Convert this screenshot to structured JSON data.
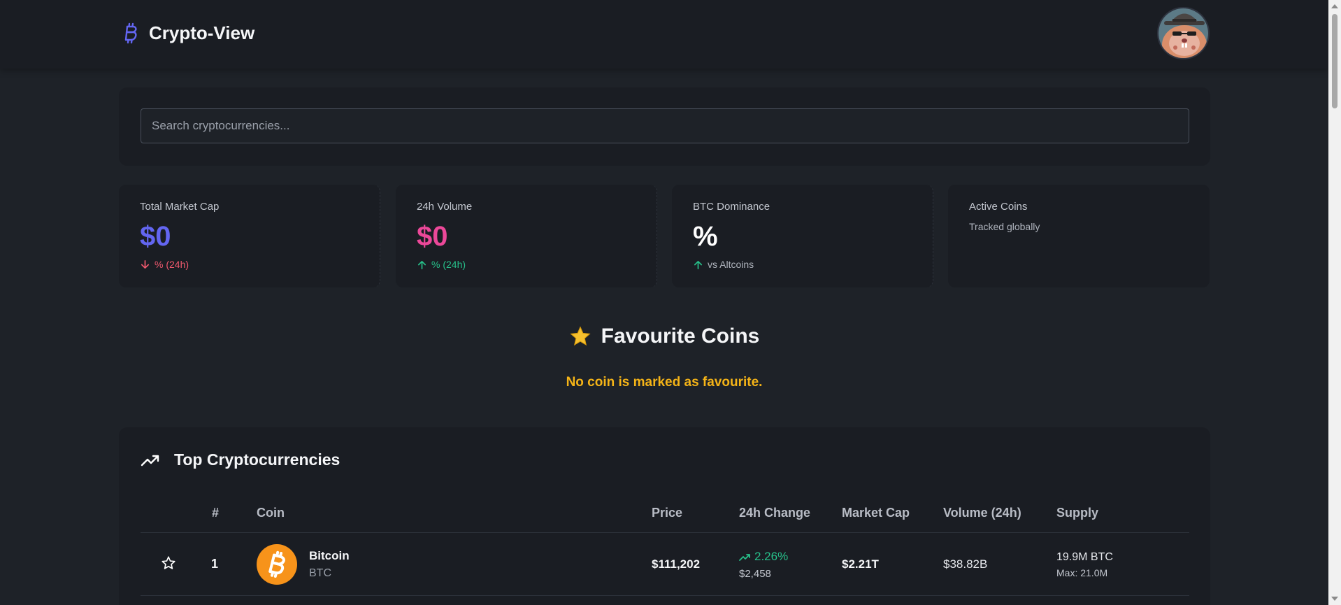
{
  "brand": {
    "title": "Crypto-View",
    "icon": "bitcoin-icon",
    "accent": "#6366f1"
  },
  "search": {
    "placeholder": "Search cryptocurrencies..."
  },
  "stats": [
    {
      "label": "Total Market Cap",
      "value": "$0",
      "sub": "% (24h)",
      "trend": "down",
      "color": "#6366f1"
    },
    {
      "label": "24h Volume",
      "value": "$0",
      "sub": "% (24h)",
      "trend": "up",
      "color": "#ec4899"
    },
    {
      "label": "BTC Dominance",
      "value": "%",
      "sub": "vs Altcoins",
      "trend": "up",
      "color": "#ffffff"
    },
    {
      "label": "Active Coins",
      "value": "",
      "sub": "Tracked globally",
      "trend": "none",
      "color": "#ffffff"
    }
  ],
  "favourites": {
    "title": "Favourite Coins",
    "icon": "star-icon",
    "empty_message": "No coin is marked as favourite."
  },
  "top": {
    "title": "Top Cryptocurrencies",
    "icon": "trending-up-icon",
    "columns": [
      "#",
      "Coin",
      "Price",
      "24h Change",
      "Market Cap",
      "Volume (24h)",
      "Supply"
    ],
    "rows": [
      {
        "rank": "1",
        "name": "Bitcoin",
        "symbol": "BTC",
        "price": "$111,202",
        "change_pct": "2.26%",
        "change_abs": "$2,458",
        "market_cap": "$2.21T",
        "volume": "$38.82B",
        "supply": "19.9M BTC",
        "max_supply": "Max: 21.0M"
      }
    ]
  },
  "colors": {
    "positive": "#27c08a",
    "negative": "#f0596e",
    "warning": "#f5b417",
    "bitcoin": "#f7931a"
  }
}
